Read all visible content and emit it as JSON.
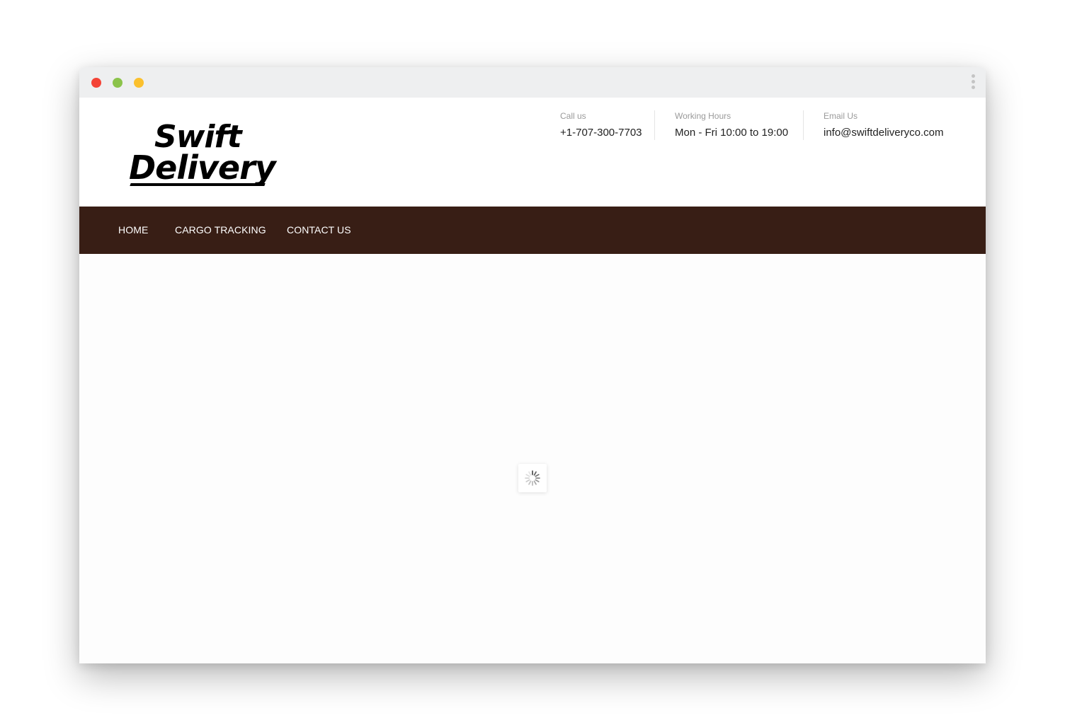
{
  "window": {
    "controls": [
      "close",
      "minimize",
      "maximize"
    ],
    "menu_icon": "kebab-menu-icon"
  },
  "brand": {
    "logo_line1": "Swift",
    "logo_line2": "Delivery"
  },
  "contact_info": {
    "call": {
      "label": "Call us",
      "value": "+1-707-300-7703"
    },
    "hours": {
      "label": "Working Hours",
      "value": "Mon - Fri 10:00 to 19:00"
    },
    "email": {
      "label": "Email Us",
      "value": "info@swiftdeliveryco.com"
    }
  },
  "nav": {
    "items": [
      {
        "label": "HOME"
      },
      {
        "label": "CARGO TRACKING"
      },
      {
        "label": "CONTACT US"
      }
    ]
  },
  "content": {
    "state": "loading",
    "spinner_icon": "loading-spinner-icon"
  },
  "colors": {
    "nav_background": "#381e15",
    "titlebar": "#eeeff0",
    "close_dot": "#f44336",
    "minimize_dot": "#8bc34a",
    "maximize_dot": "#fbc02d"
  }
}
